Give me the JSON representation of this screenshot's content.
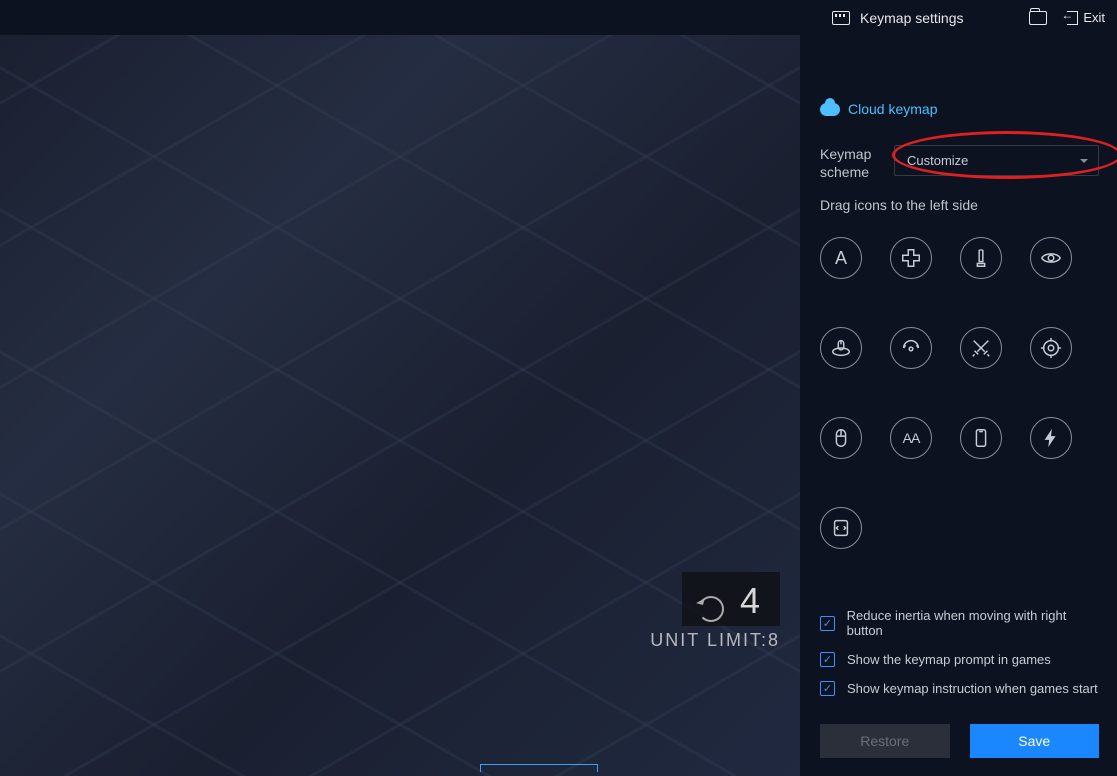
{
  "topbar": {
    "title": "Keymap settings",
    "exit": "Exit"
  },
  "panel": {
    "cloud_link": "Cloud keymap",
    "scheme_label": "Keymap scheme",
    "scheme_value": "Customize",
    "drag_hint": "Drag icons to the left side",
    "icons": [
      {
        "name": "letter-a-icon"
      },
      {
        "name": "dpad-icon"
      },
      {
        "name": "bullet-icon"
      },
      {
        "name": "eye-icon"
      },
      {
        "name": "mouse-orbit-icon"
      },
      {
        "name": "tilt-icon"
      },
      {
        "name": "swords-icon"
      },
      {
        "name": "crosshair-icon"
      },
      {
        "name": "mouse-icon"
      },
      {
        "name": "double-a-icon"
      },
      {
        "name": "device-icon"
      },
      {
        "name": "bolt-icon"
      },
      {
        "name": "script-icon"
      }
    ],
    "checks": [
      {
        "label": "Reduce inertia when moving with right button",
        "checked": true
      },
      {
        "label": "Show the keymap prompt in games",
        "checked": true
      },
      {
        "label": "Show keymap instruction when games start",
        "checked": true
      }
    ],
    "restore": "Restore",
    "save": "Save"
  },
  "hud": {
    "count": "4",
    "limit": "UNIT LIMIT:8"
  }
}
